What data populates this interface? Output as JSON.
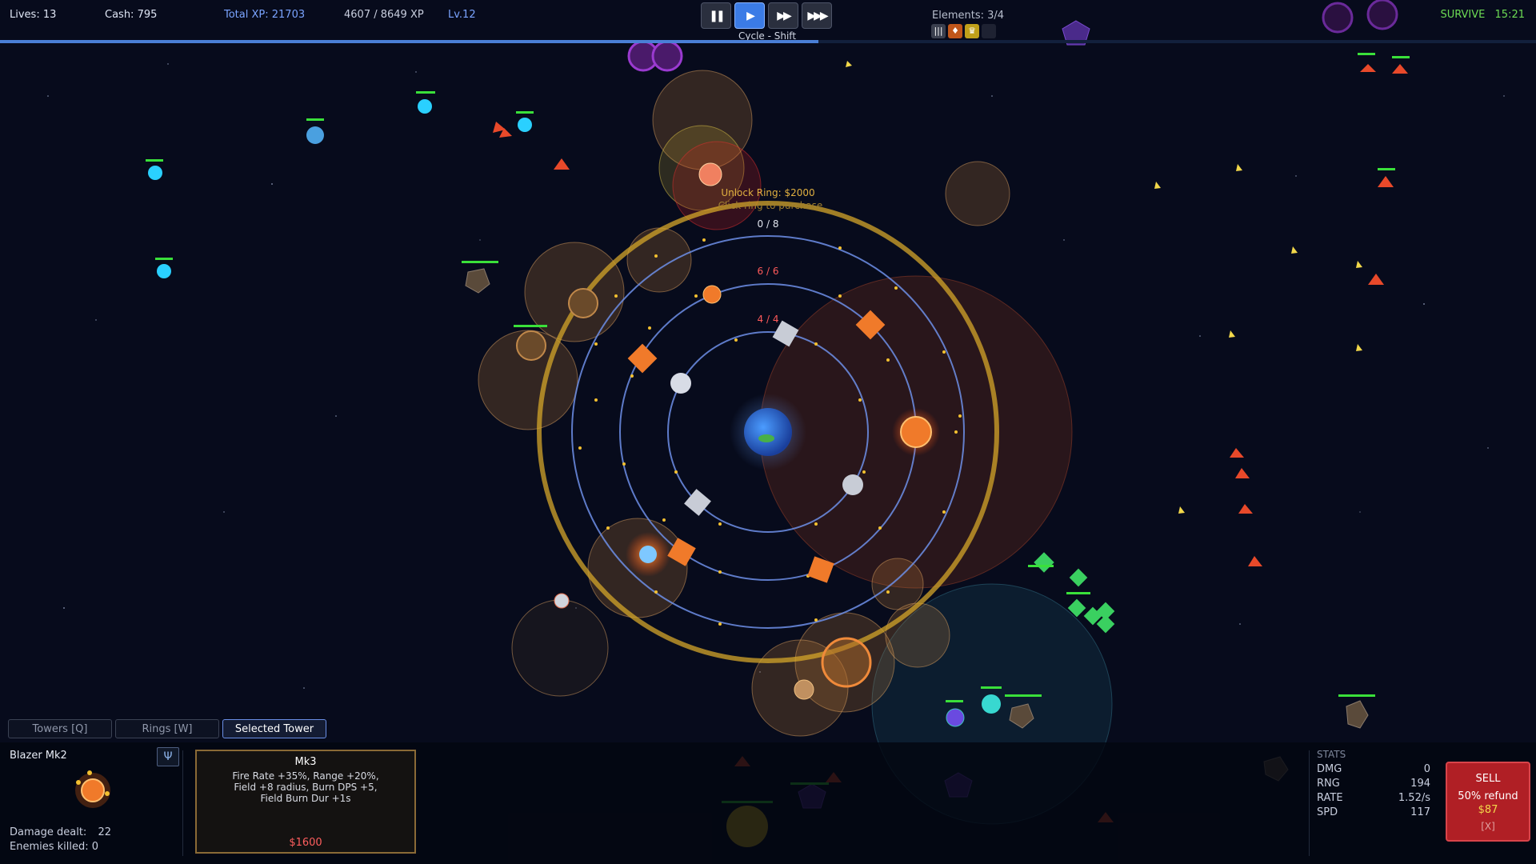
{
  "hud": {
    "lives": "Lives: 13",
    "cash": "Cash: 795",
    "total_xp": "Total XP: 21703",
    "level_xp": "4607 / 8649 XP",
    "level": "Lv.12",
    "xp_progress": 0.533,
    "cycle_hint": "Cycle - Shift",
    "elements": "Elements: 3/4",
    "survive": "SURVIVE",
    "timer": "15:21"
  },
  "controls": {
    "pause": "❚❚",
    "play": "▶",
    "fast": "▶▶",
    "faster": "▶▶▶"
  },
  "rings": {
    "unlock_label": "Unlock Ring: $2000",
    "unlock_hint": "Click ring to purchase",
    "outer_count": "0 / 8",
    "middle_count": "6 / 6",
    "inner_count": "4 / 4"
  },
  "tabs": {
    "towers": "Towers [Q]",
    "rings": "Rings [W]",
    "selected": "Selected Tower"
  },
  "tower": {
    "name": "Blazer Mk2",
    "damage_dealt": "Damage dealt:",
    "damage_value": "22",
    "enemies_killed": "Enemies killed: 0"
  },
  "upgrade": {
    "title": "Mk3",
    "description": "Fire Rate +35%, Range +20%,\nField +8 radius, Burn DPS +5,\nField Burn Dur +1s",
    "cost": "$1600"
  },
  "stats": {
    "header": "STATS",
    "rows": [
      {
        "label": "DMG",
        "value": "0"
      },
      {
        "label": "RNG",
        "value": "194"
      },
      {
        "label": "RATE",
        "value": "1.52/s"
      },
      {
        "label": "SPD",
        "value": "117"
      }
    ]
  },
  "sell": {
    "label": "SELL",
    "refund": "50% refund",
    "amount": "$87",
    "key": "[X]"
  },
  "colors": {
    "accent_blue": "#3b7be6",
    "xp_fill": "#4a7fd6",
    "sell_red": "#b01f25",
    "survive_green": "#6ddc54",
    "ring_gold": "#d4a62a",
    "ring_blue": "#6d8fe8",
    "tower_orange": "#f07a2a",
    "enemy_red": "#e8492a"
  },
  "icons": {
    "element_1": "bars-icon",
    "element_2": "flame-icon",
    "element_3": "crown-icon",
    "tower_type": "antenna-icon"
  }
}
